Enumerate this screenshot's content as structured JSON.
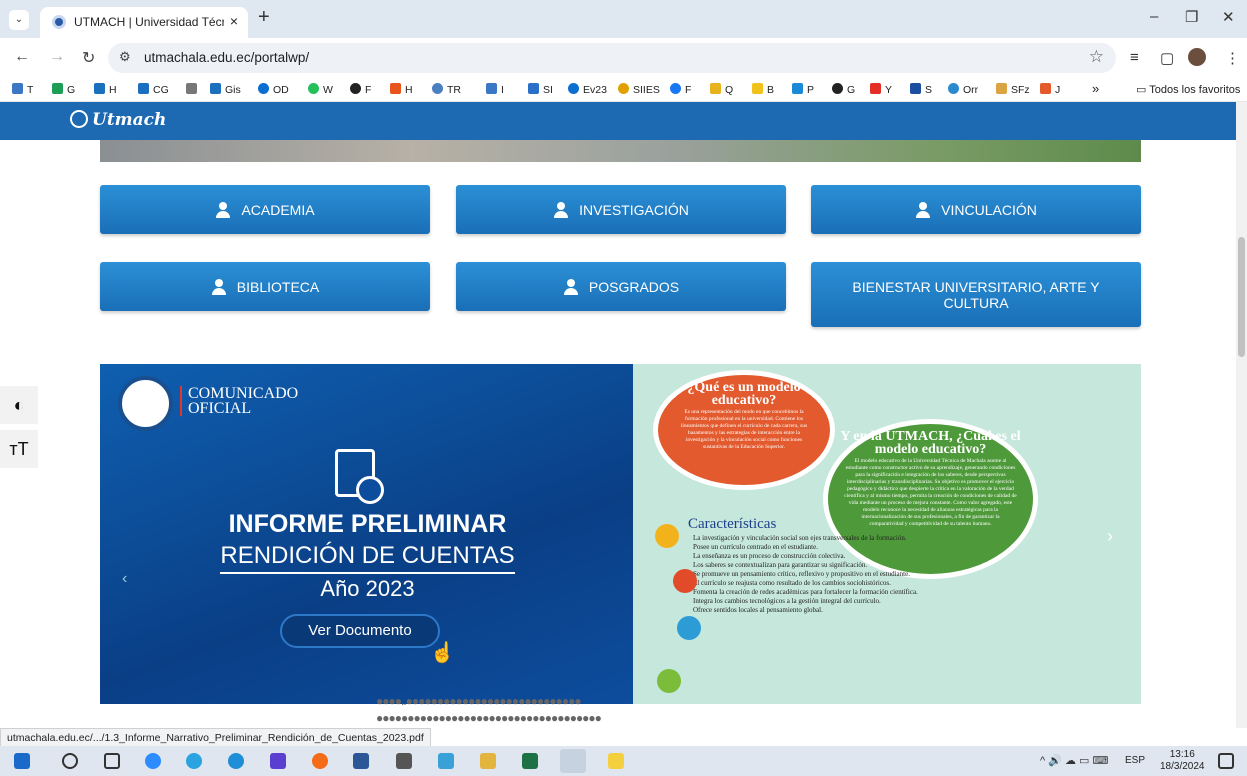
{
  "browser": {
    "tab_title": "UTMACH | Universidad Técnica",
    "tab_close": "×",
    "new_tab": "+",
    "url": "utmachala.edu.ec/portalwp/",
    "minimize": "–",
    "maximize": "❐",
    "close": "✕",
    "bookmarks": [
      "T",
      "G",
      "H",
      "CG",
      "",
      "Gis",
      "OD",
      "W",
      "F",
      "H",
      "TR",
      "I",
      "SI",
      "Ev23",
      "SIIES",
      "F",
      "Q",
      "B",
      "P",
      "G",
      "Y",
      "S",
      "Orr",
      "SFz",
      "J"
    ],
    "bookmarks_more": "»",
    "all_bookmarks": "Todos los favoritos"
  },
  "site": {
    "logo_text": "Utmach",
    "nav_buttons": [
      "ACADEMIA",
      "INVESTIGACIÓN",
      "VINCULACIÓN",
      "BIBLIOTECA",
      "POSGRADOS",
      "BIENESTAR UNIVERSITARIO, ARTE Y CULTURA"
    ],
    "slide1": {
      "header_line1": "COMUNICADO",
      "header_line2": "OFICIAL",
      "title1": "INFORME PRELIMINAR",
      "title2": "RENDICIÓN DE CUENTAS",
      "year": "Año 2023",
      "button": "Ver Documento"
    },
    "slide2": {
      "q1_title": "¿Qué es un modelo educativo?",
      "q1_body": "Es una representación del modo en que concebimos la formación profesional en la universidad. Contiene los lineamientos que definen el currículo de cada carrera, sus basamentos y las estrategias de interacción entre la investigación y la vinculación social como funciones sustantivas de la Educación Superior.",
      "q2_title": "Y en la UTMACH, ¿Cuál es el modelo educativo?",
      "q2_body": "El modelo educativo de la Universidad Técnica de Machala asume al estudiante como constructor activo de su aprendizaje, generando condiciones para la significación e integración de los saberes, desde perspectivas interdisciplinarias y transdisciplinarias. Su objetivo es promover el ejercicio pedagógico y didáctico que despierte la crítica en la valoración de la verdad científica y al mismo tiempo, permita la creación de condiciones de calidad de vida mediante un proceso de mejora constante. Como valor agregado, este modelo reconoce la necesidad de alianzas estratégicas para la internacionalización de sus profesionales, a fin de garantizar la comparatividad y competitividad de su talento humano.",
      "carac_title": "Características",
      "carac_items": [
        "La investigación y vinculación social son ejes transversales de la formación.",
        "Posee un currículo centrado en el estudiante.",
        "La enseñanza es un proceso de construcción colectiva.",
        "Los saberes se contextualizan para garantizar su significación.",
        "Se promueve un pensamiento crítico, reflexivo y propositivo en el estudiante.",
        "El currículo se reajusta como resultado de los cambios sociohistóricos.",
        "Fomenta la creación de redes académicas para fortalecer la formación científica.",
        "Integra los cambios tecnológicos a la gestión integral del currículo.",
        "Ofrece sentidos locales al pensamiento global."
      ]
    },
    "a11y_contrast": "◐",
    "a11y_text": "тT"
  },
  "status_url": "utmachala.edu.ec/.../1.3_Informe_Narrativo_Preliminar_Rendición_de_Cuentas_2023.pdf",
  "taskbar": {
    "lang": "ESP",
    "time": "13:16",
    "date": "18/3/2024"
  },
  "colors": {
    "nav_blue": "#1d6ab3",
    "button_blue": "#2b90d6"
  }
}
